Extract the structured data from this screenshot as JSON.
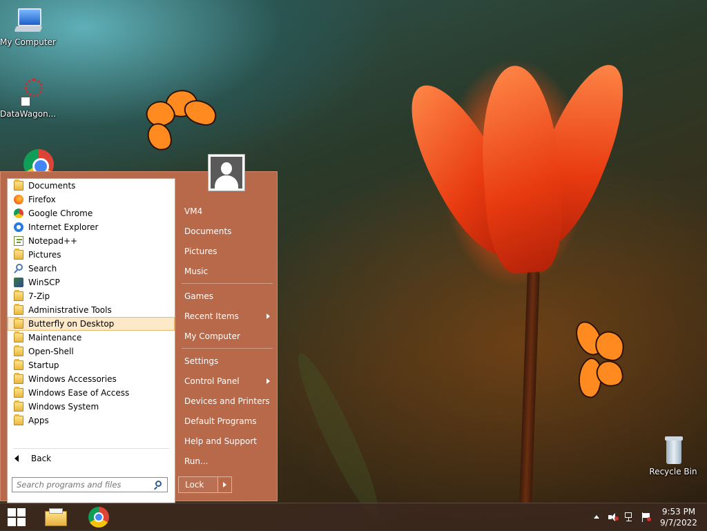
{
  "desktop": {
    "icons": [
      {
        "label": "My Computer",
        "icon": "computer-icon"
      },
      {
        "label": "DataWagon...",
        "icon": "datawagon-shortcut-icon"
      },
      {
        "label": "Recycle Bin",
        "icon": "recycle-bin-icon"
      }
    ]
  },
  "start_menu": {
    "programs": [
      {
        "label": "Documents",
        "icon": "documents-folder-icon"
      },
      {
        "label": "Firefox",
        "icon": "firefox-icon"
      },
      {
        "label": "Google Chrome",
        "icon": "chrome-icon"
      },
      {
        "label": "Internet Explorer",
        "icon": "internet-explorer-icon"
      },
      {
        "label": "Notepad++",
        "icon": "notepadpp-icon"
      },
      {
        "label": "Pictures",
        "icon": "pictures-folder-icon"
      },
      {
        "label": "Search",
        "icon": "search-icon"
      },
      {
        "label": "WinSCP",
        "icon": "winscp-icon"
      },
      {
        "label": "7-Zip",
        "icon": "folder-icon"
      },
      {
        "label": "Administrative Tools",
        "icon": "folder-icon"
      },
      {
        "label": "Butterfly on Desktop",
        "icon": "folder-icon",
        "selected": true
      },
      {
        "label": "Maintenance",
        "icon": "folder-icon"
      },
      {
        "label": "Open-Shell",
        "icon": "folder-icon"
      },
      {
        "label": "Startup",
        "icon": "folder-icon"
      },
      {
        "label": "Windows Accessories",
        "icon": "folder-icon"
      },
      {
        "label": "Windows Ease of Access",
        "icon": "folder-icon"
      },
      {
        "label": "Windows System",
        "icon": "folder-icon"
      },
      {
        "label": "Apps",
        "icon": "apps-folder-icon"
      }
    ],
    "back_label": "Back",
    "search_placeholder": "Search programs and files",
    "right_items": {
      "user": "VM4",
      "documents": "Documents",
      "pictures": "Pictures",
      "music": "Music",
      "games": "Games",
      "recent_items": "Recent Items",
      "my_computer": "My Computer",
      "settings": "Settings",
      "control_panel": "Control Panel",
      "devices_printers": "Devices and Printers",
      "default_programs": "Default Programs",
      "help_support": "Help and Support",
      "run": "Run..."
    },
    "lock_label": "Lock"
  },
  "taskbar": {
    "time": "9:53 PM",
    "date": "9/7/2022",
    "colors": {
      "accent": "#b7694a",
      "selection": "#fde8c8"
    }
  }
}
